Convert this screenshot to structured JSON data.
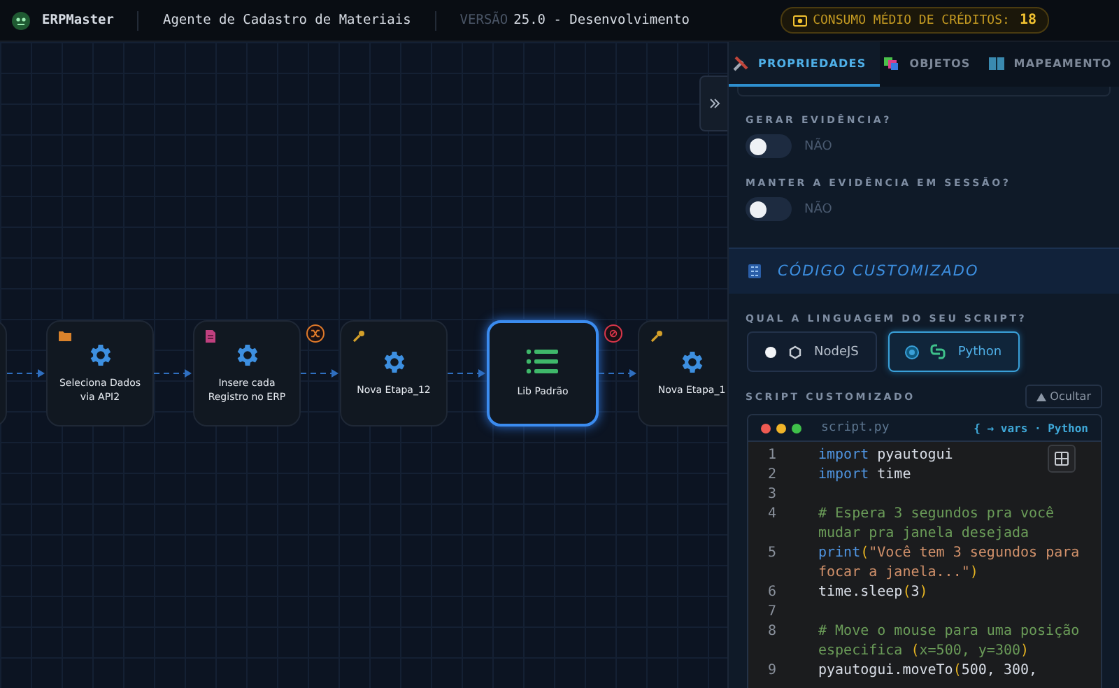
{
  "header": {
    "app_name": "ERPMaster",
    "agent": "Agente de Cadastro de Materiais",
    "version_label": "VERSÃO",
    "version": "25.0 - Desenvolvimento",
    "credits_label": "CONSUMO MÉDIO DE CRÉDITOS:",
    "credits_value": "18"
  },
  "canvas": {
    "nodes": [
      {
        "kind": "plain",
        "selected": false
      },
      {
        "label": "Seleciona Dados via API2",
        "kind": "fetch",
        "selected": false
      },
      {
        "label": "Insere cada Registro no ERP",
        "kind": "insert",
        "selected": false
      },
      {
        "label": "Nova Etapa_12",
        "kind": "action",
        "selected": false
      },
      {
        "label": "Lib Padrão",
        "kind": "library",
        "selected": true
      },
      {
        "label": "Nova Etapa_1",
        "kind": "action",
        "selected": false
      }
    ],
    "connectors": [
      {
        "kind": "plain"
      },
      {
        "kind": "plain"
      },
      {
        "kind": "shuffle"
      },
      {
        "kind": "plain"
      },
      {
        "kind": "stop"
      }
    ]
  },
  "panel": {
    "tabs": [
      {
        "label": "PROPRIEDADES",
        "selected": true
      },
      {
        "label": "OBJETOS",
        "selected": false
      },
      {
        "label": "MAPEAMENTO",
        "selected": false
      }
    ],
    "toggles": [
      {
        "label": "GERAR EVIDÊNCIA?",
        "on": false,
        "state_text": "NÃO"
      },
      {
        "label": "MANTER A EVIDÊNCIA EM SESSÃO?",
        "on": false,
        "state_text": "NÃO"
      }
    ],
    "section_title": "CÓDIGO CUSTOMIZADO",
    "language_label": "QUAL A LINGUAGEM DO SEU SCRIPT?",
    "languages": [
      {
        "label": "NodeJS",
        "kind": "node",
        "selected": false
      },
      {
        "label": "Python",
        "kind": "python",
        "selected": true
      }
    ],
    "script_label": "SCRIPT CUSTOMIZADO",
    "hide_button": "Ocultar",
    "editor": {
      "filename": "script.py",
      "vars_hint": "{ → vars · Python",
      "lines": [
        {
          "number": "1",
          "tokens": [
            {
              "kind": "keyword",
              "text": "import"
            },
            {
              "kind": "plain",
              "text": " pyautogui"
            }
          ]
        },
        {
          "number": "2",
          "tokens": [
            {
              "kind": "keyword",
              "text": "import"
            },
            {
              "kind": "plain",
              "text": " time"
            }
          ]
        },
        {
          "number": "3"
        },
        {
          "number": "4",
          "tokens": [
            {
              "kind": "comment",
              "text": "# Espera 3 segundos pra você mudar pra janela desejada"
            }
          ]
        },
        {
          "number": "5",
          "tokens": [
            {
              "kind": "keyword",
              "text": "print"
            },
            {
              "kind": "paren",
              "text": "("
            },
            {
              "kind": "string",
              "text": "\"Você tem 3 segundos para focar a janela...\""
            },
            {
              "kind": "paren",
              "text": ")"
            }
          ]
        },
        {
          "number": "6",
          "tokens": [
            {
              "kind": "plain",
              "text": "time.sleep"
            },
            {
              "kind": "paren",
              "text": "("
            },
            {
              "kind": "number",
              "text": "3"
            },
            {
              "kind": "paren",
              "text": ")"
            }
          ]
        },
        {
          "number": "7"
        },
        {
          "number": "8",
          "tokens": [
            {
              "kind": "comment",
              "text": "# Move o mouse para uma posição especifica "
            },
            {
              "kind": "paren",
              "text": "("
            },
            {
              "kind": "comment",
              "text": "x=500, y=300"
            },
            {
              "kind": "paren",
              "text": ")"
            }
          ]
        },
        {
          "number": "9",
          "tokens": [
            {
              "kind": "plain",
              "text": "pyautogui.moveTo"
            },
            {
              "kind": "paren",
              "text": "("
            },
            {
              "kind": "plain",
              "text": "500, 300,"
            }
          ]
        }
      ]
    }
  }
}
